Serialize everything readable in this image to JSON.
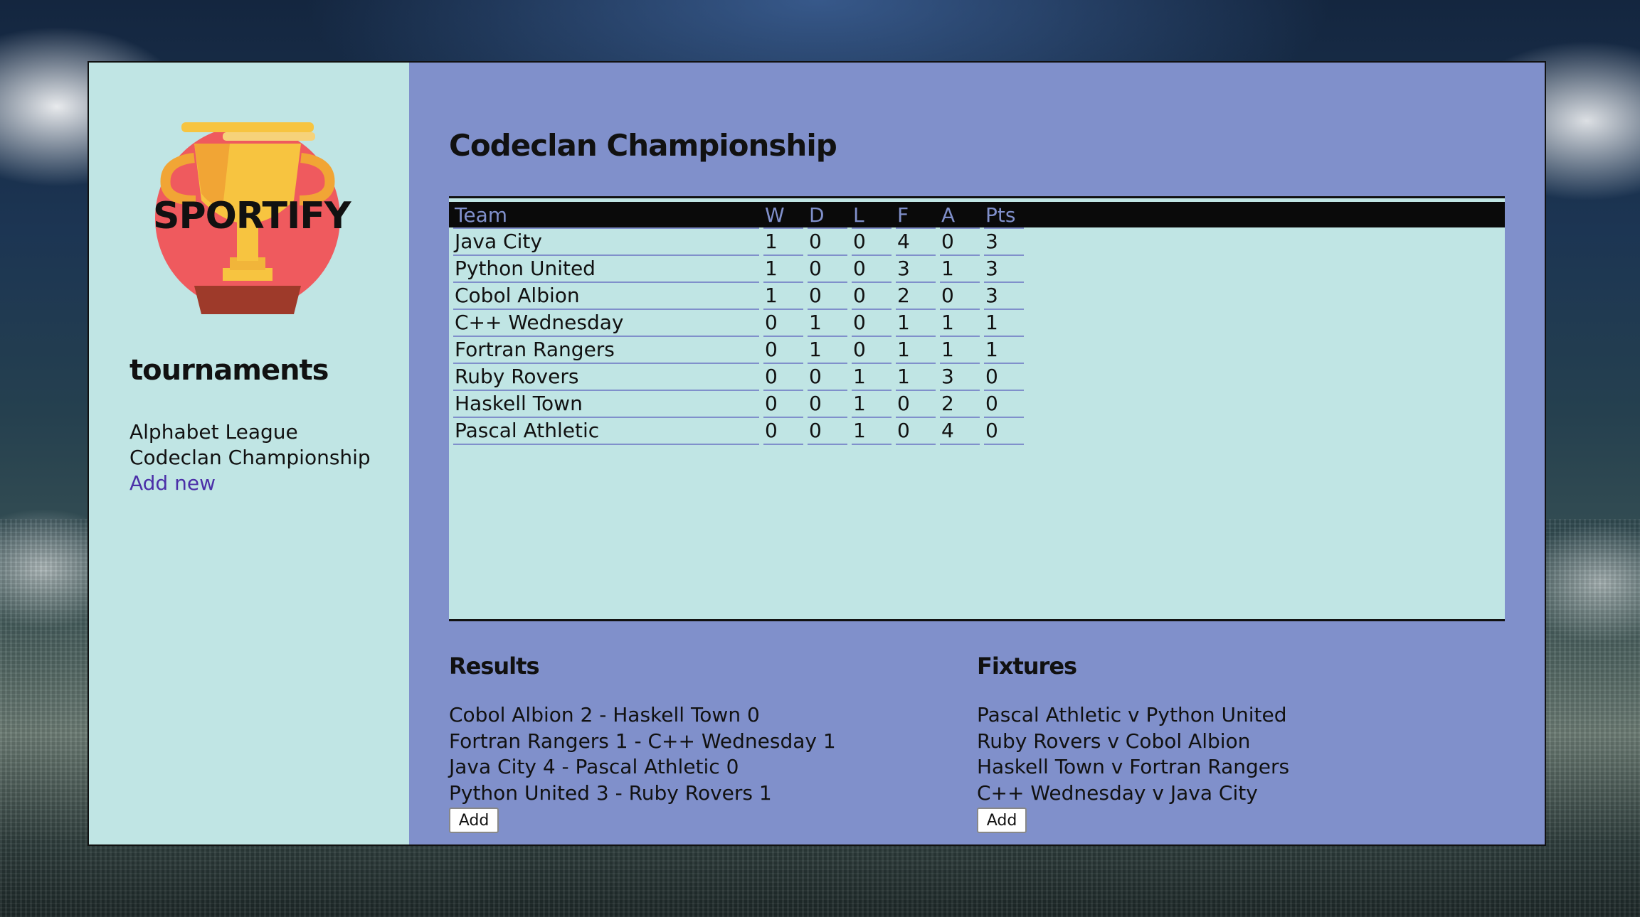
{
  "sidebar": {
    "logo_text": "SPORTIFY",
    "heading": "tournaments",
    "tournaments": [
      "Alphabet League",
      "Codeclan Championship"
    ],
    "add_new_label": "Add new"
  },
  "main": {
    "title": "Codeclan Championship",
    "table": {
      "headers": [
        "Team",
        "W",
        "D",
        "L",
        "F",
        "A",
        "Pts"
      ],
      "rows": [
        [
          "Java City",
          "1",
          "0",
          "0",
          "4",
          "0",
          "3"
        ],
        [
          "Python United",
          "1",
          "0",
          "0",
          "3",
          "1",
          "3"
        ],
        [
          "Cobol Albion",
          "1",
          "0",
          "0",
          "2",
          "0",
          "3"
        ],
        [
          "C++ Wednesday",
          "0",
          "1",
          "0",
          "1",
          "1",
          "1"
        ],
        [
          "Fortran Rangers",
          "0",
          "1",
          "0",
          "1",
          "1",
          "1"
        ],
        [
          "Ruby Rovers",
          "0",
          "0",
          "1",
          "1",
          "3",
          "0"
        ],
        [
          "Haskell Town",
          "0",
          "0",
          "1",
          "0",
          "2",
          "0"
        ],
        [
          "Pascal Athletic",
          "0",
          "0",
          "1",
          "0",
          "4",
          "0"
        ]
      ]
    },
    "results": {
      "title": "Results",
      "items": [
        "Cobol Albion 2 - Haskell Town 0",
        "Fortran Rangers 1 - C++ Wednesday 1",
        "Java City 4 - Pascal Athletic 0",
        "Python United 3 - Ruby Rovers 1"
      ],
      "add_label": "Add"
    },
    "fixtures": {
      "title": "Fixtures",
      "items": [
        "Pascal Athletic v Python United",
        "Ruby Rovers v Cobol Albion",
        "Haskell Town v Fortran Rangers",
        "C++ Wednesday v Java City"
      ],
      "add_label": "Add"
    }
  },
  "colors": {
    "sidebar_bg": "#c0e5e4",
    "main_bg": "#8090cb",
    "table_header_bg": "#0a0a0a",
    "link": "#4b2fa8",
    "trophy_gold": "#f7c440",
    "trophy_circle": "#ef5a5e"
  }
}
